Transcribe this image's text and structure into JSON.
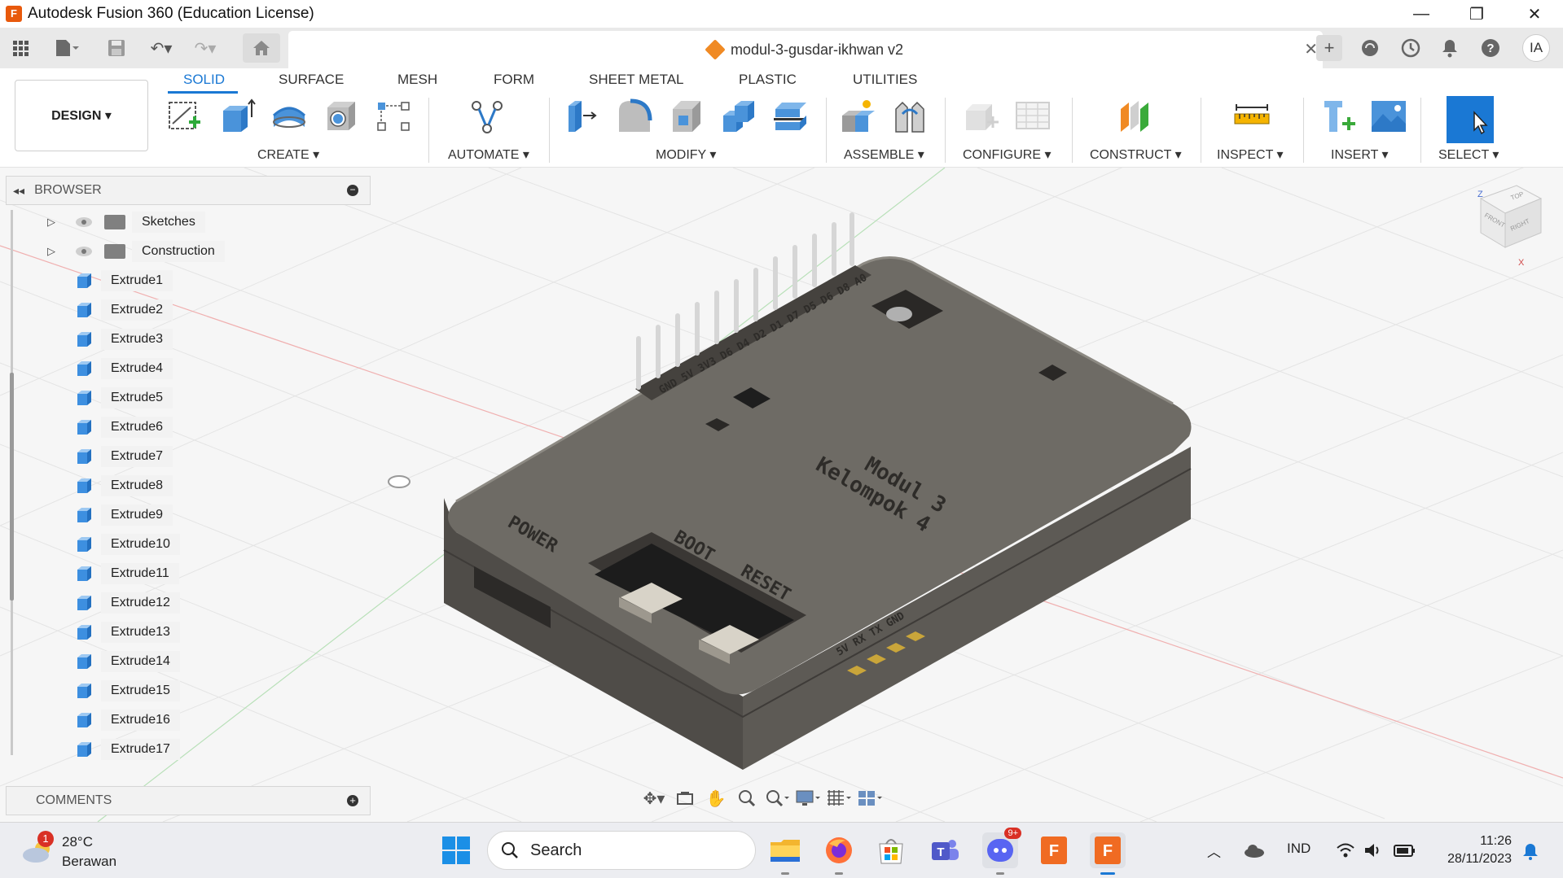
{
  "window": {
    "title": "Autodesk Fusion 360 (Education License)",
    "app_icon": "F",
    "minimize": "—",
    "restore": "❐",
    "close": "✕"
  },
  "document": {
    "name": "modul-3-gusdar-ikhwan v2",
    "close": "✕"
  },
  "user": {
    "initials": "IA"
  },
  "ribbon": {
    "workspace": "DESIGN ▾",
    "tabs": [
      "SOLID",
      "SURFACE",
      "MESH",
      "FORM",
      "SHEET METAL",
      "PLASTIC",
      "UTILITIES"
    ],
    "active_tab": "SOLID",
    "groups": {
      "create": "CREATE ▾",
      "automate": "AUTOMATE ▾",
      "modify": "MODIFY ▾",
      "assemble": "ASSEMBLE ▾",
      "configure": "CONFIGURE ▾",
      "construct": "CONSTRUCT ▾",
      "inspect": "INSPECT ▾",
      "insert": "INSERT ▾",
      "select": "SELECT ▾"
    },
    "accent": "#1a78d4"
  },
  "browser": {
    "title": "BROWSER",
    "folders": [
      "Sketches",
      "Construction"
    ],
    "bodies": [
      "Extrude1",
      "Extrude2",
      "Extrude3",
      "Extrude4",
      "Extrude5",
      "Extrude6",
      "Extrude7",
      "Extrude8",
      "Extrude9",
      "Extrude10",
      "Extrude11",
      "Extrude12",
      "Extrude13",
      "Extrude14",
      "Extrude15",
      "Extrude16",
      "Extrude17"
    ]
  },
  "comments": {
    "title": "COMMENTS"
  },
  "viewcube": {
    "top": "TOP",
    "front": "FRONT",
    "right": "RIGHT",
    "axis_z": "Z",
    "axis_x": "X"
  },
  "model": {
    "pin_labels": "GND 5V 3V3 D6 D4 D2 D1 D7 D5 D6 D8 A0",
    "title_line1": "Modul 3",
    "title_line2": "Kelompok 4",
    "power": "POWER",
    "boot": "BOOT",
    "reset": "RESET",
    "uart": "5V RX TX GND"
  },
  "taskbar": {
    "weather_temp": "28°C",
    "weather_cond": "Berawan",
    "weather_badge": "1",
    "search": "Search",
    "discord_badge": "9+",
    "language": "IND",
    "time": "11:26",
    "date": "28/11/2023"
  }
}
